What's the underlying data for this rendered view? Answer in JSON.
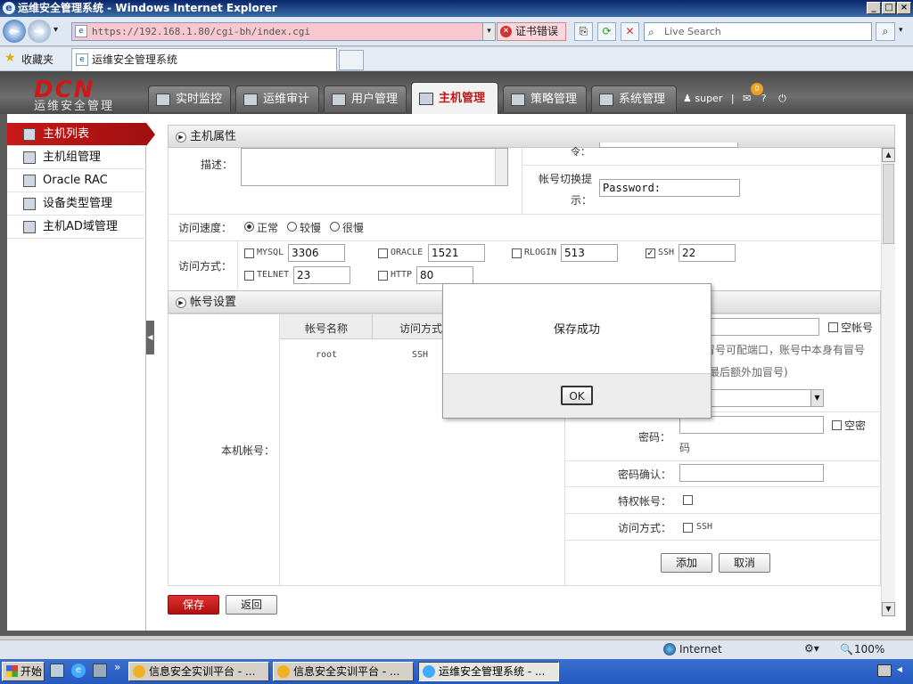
{
  "window": {
    "title": "运维安全管理系统 - Windows Internet Explorer"
  },
  "browser": {
    "url": "https://192.168.1.80/cgi-bh/index.cgi",
    "cert_error": "证书错误",
    "search_placeholder": "Live Search",
    "favorites": "收藏夹",
    "tab_title": "运维安全管理系统"
  },
  "app": {
    "logo": "DCN",
    "logo_sub": "运维安全管理",
    "nav": [
      "实时监控",
      "运维审计",
      "用户管理",
      "主机管理",
      "策略管理",
      "系统管理"
    ],
    "user": "super",
    "badge": "0",
    "sep": "|",
    "help": "?"
  },
  "sidebar": [
    "主机列表",
    "主机组管理",
    "Oracle RAC",
    "设备类型管理",
    "主机AD域管理"
  ],
  "host_props": {
    "section_title": "主机属性",
    "desc_label": "描述：",
    "cut_label": "令：",
    "hint_label_1": "帐号切换提",
    "hint_label_2": "示：",
    "hint_value": "Password:",
    "speed_label": "访问速度：",
    "speed_options": [
      "正常",
      "较慢",
      "很慢"
    ],
    "access_label": "访问方式：",
    "protocols": [
      {
        "name": "MYSQL",
        "port": "3306",
        "checked": false
      },
      {
        "name": "ORACLE",
        "port": "1521",
        "checked": false
      },
      {
        "name": "RLOGIN",
        "port": "513",
        "checked": false
      },
      {
        "name": "SSH",
        "port": "22",
        "checked": true
      },
      {
        "name": "TELNET",
        "port": "23",
        "checked": false
      },
      {
        "name": "HTTP",
        "port": "80",
        "checked": false
      }
    ]
  },
  "account": {
    "section_title": "帐号设置",
    "local_label": "本机帐号：",
    "col_name": "帐号名称",
    "col_access": "访问方式",
    "row_name": "root",
    "row_access": "SSH",
    "empty_account": "空帐号",
    "note_1": "冒号可配端口，账号中本身有冒号",
    "note_2": "最后额外加冒号)",
    "pwd_label": "密码：",
    "empty_pwd_1": "空密",
    "empty_pwd_2": "码",
    "pwd_confirm": "密码确认：",
    "privileged": "特权帐号：",
    "access_label": "访问方式：",
    "access_ssh": "SSH",
    "add": "添加",
    "cancel": "取消"
  },
  "actions": {
    "save": "保存",
    "back": "返回"
  },
  "modal": {
    "message": "保存成功",
    "ok": "OK"
  },
  "status": {
    "zone": "Internet",
    "zoom": "100%"
  },
  "taskbar": {
    "start": "开始",
    "items": [
      "信息安全实训平台 - ...",
      "信息安全实训平台 - ...",
      "运维安全管理系统 - ..."
    ]
  },
  "colors": {
    "brand_red": "#c81818",
    "header_gray": "#5c5c5c",
    "title_blue": "#0a246a"
  }
}
